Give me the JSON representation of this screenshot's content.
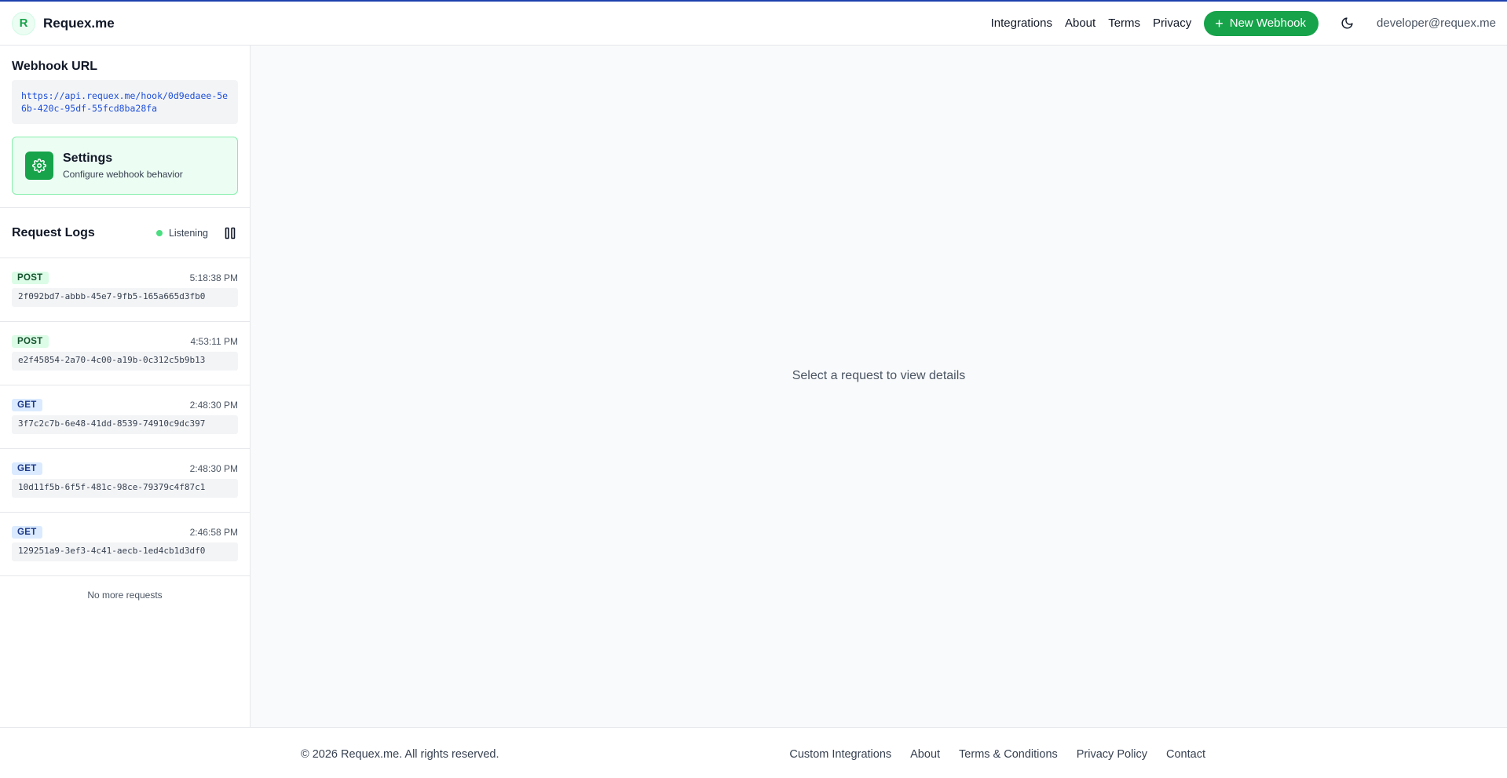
{
  "header": {
    "brand_letter": "R",
    "brand_name": "Requex.me",
    "nav": [
      "Integrations",
      "About",
      "Terms",
      "Privacy"
    ],
    "new_webhook_label": "New Webhook",
    "user_email": "developer@requex.me"
  },
  "sidebar": {
    "webhook_title": "Webhook URL",
    "webhook_url": "https://api.requex.me/hook/0d9edaee-5e6b-420c-95df-55fcd8ba28fa",
    "settings": {
      "title": "Settings",
      "subtitle": "Configure webhook behavior"
    },
    "logs_title": "Request Logs",
    "status": "Listening",
    "logs": [
      {
        "method": "POST",
        "time": "5:18:38 PM",
        "id": "2f092bd7-abbb-45e7-9fb5-165a665d3fb0"
      },
      {
        "method": "POST",
        "time": "4:53:11 PM",
        "id": "e2f45854-2a70-4c00-a19b-0c312c5b9b13"
      },
      {
        "method": "GET",
        "time": "2:48:30 PM",
        "id": "3f7c2c7b-6e48-41dd-8539-74910c9dc397"
      },
      {
        "method": "GET",
        "time": "2:48:30 PM",
        "id": "10d11f5b-6f5f-481c-98ce-79379c4f87c1"
      },
      {
        "method": "GET",
        "time": "2:46:58 PM",
        "id": "129251a9-3ef3-4c41-aecb-1ed4cb1d3df0"
      }
    ],
    "no_more": "No more requests"
  },
  "main": {
    "empty_message": "Select a request to view details"
  },
  "footer": {
    "copyright": "© 2026 Requex.me. All rights reserved.",
    "links": [
      "Custom Integrations",
      "About",
      "Terms & Conditions",
      "Privacy Policy",
      "Contact"
    ]
  },
  "colors": {
    "accent_green": "#16a34a",
    "top_border": "#1e40af",
    "post_badge": "#dcfce7",
    "get_badge": "#dbeafe",
    "live_dot": "#4ade80"
  }
}
